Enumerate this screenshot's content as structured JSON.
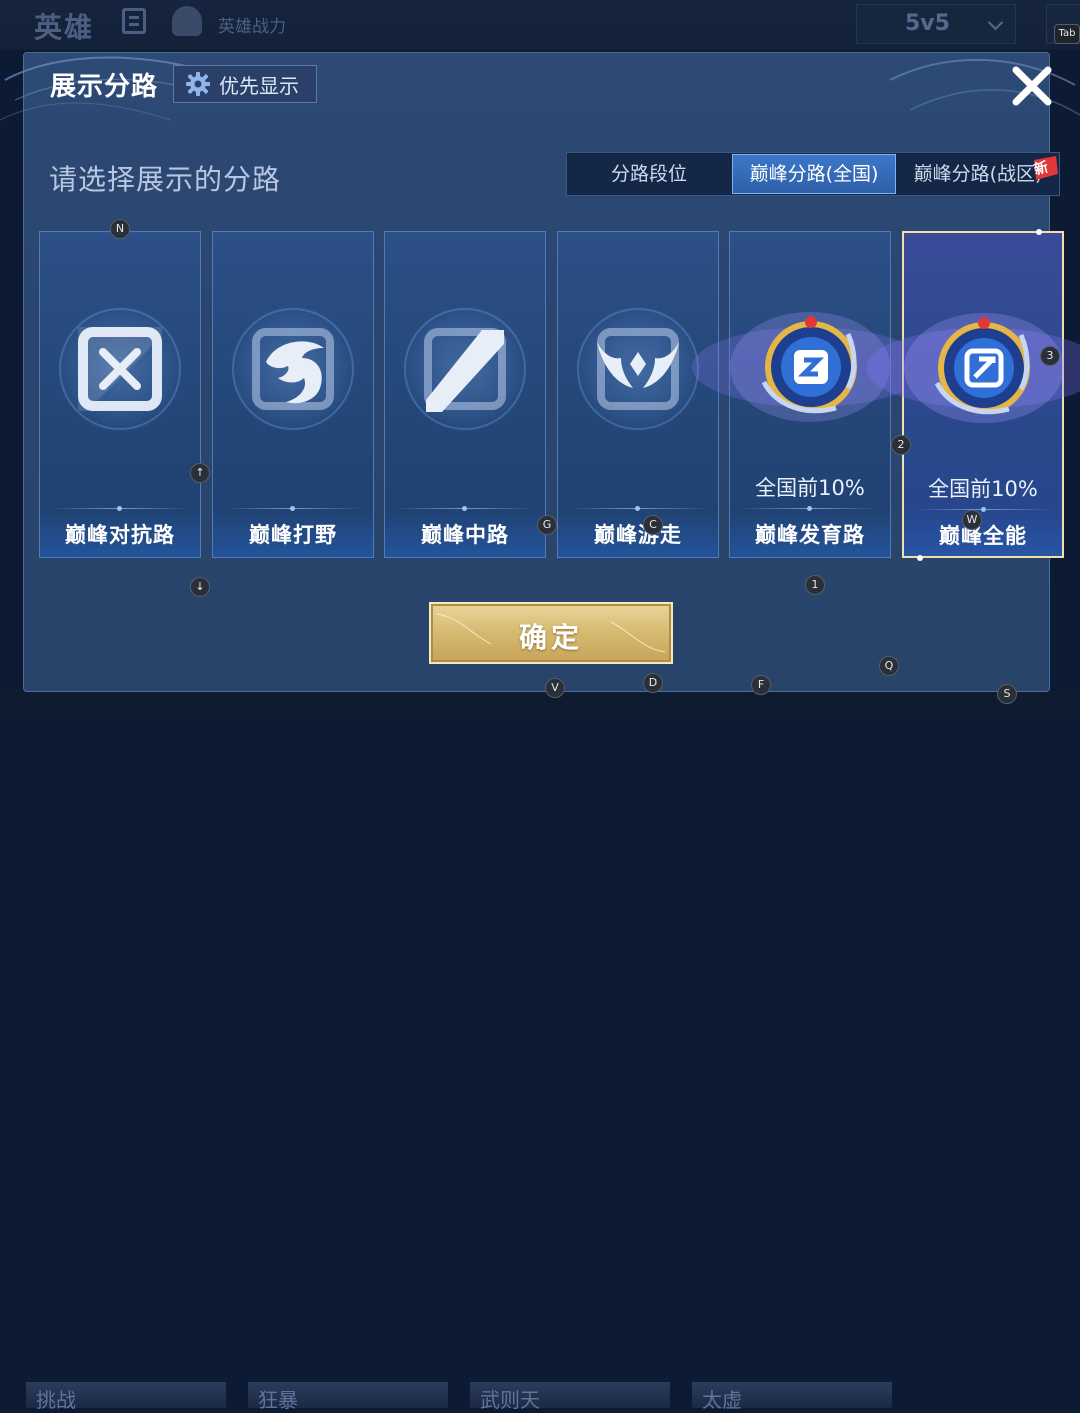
{
  "background": {
    "title": "英雄",
    "power_label": "英雄战力",
    "mode_value": "5v5",
    "bottom_cards": [
      "挑战",
      "狂暴",
      "武则天",
      "太虚"
    ]
  },
  "dialog": {
    "title": "展示分路",
    "priority_button_label": "优先显示",
    "subtitle": "请选择展示的分路",
    "tabs": [
      {
        "label": "分路段位",
        "active": false
      },
      {
        "label": "巅峰分路(全国)",
        "active": true
      },
      {
        "label": "巅峰分路(战区)",
        "active": false
      }
    ],
    "new_badge": "新",
    "confirm_label": "确定"
  },
  "lanes": [
    {
      "label": "巅峰对抗路",
      "rank": "",
      "emblem": "clash-lane-icon",
      "selected": false
    },
    {
      "label": "巅峰打野",
      "rank": "",
      "emblem": "jungle-dragon-icon",
      "selected": false
    },
    {
      "label": "巅峰中路",
      "rank": "",
      "emblem": "mid-lane-icon",
      "selected": false
    },
    {
      "label": "巅峰游走",
      "rank": "",
      "emblem": "roam-wings-icon",
      "selected": false
    },
    {
      "label": "巅峰发育路",
      "rank": "全国前10%",
      "emblem": "farm-lane-badge-icon",
      "selected": false
    },
    {
      "label": "巅峰全能",
      "rank": "全国前10%",
      "emblem": "all-round-badge-icon",
      "selected": true
    }
  ],
  "hotkeys": {
    "tab": "Tab",
    "n": "N",
    "up": "↑",
    "down": "↓",
    "g": "G",
    "c": "C",
    "w": "W",
    "three": "3",
    "two": "2",
    "one": "1",
    "q": "Q",
    "d": "D",
    "v": "V",
    "f": "F",
    "s": "S"
  },
  "colors": {
    "dialog_bg": "#2d4a74",
    "tab_active": "#3b78c8",
    "selected_border": "#f2dfae",
    "confirm_gold": "#d6b970",
    "new_badge_red": "#e0373a"
  }
}
